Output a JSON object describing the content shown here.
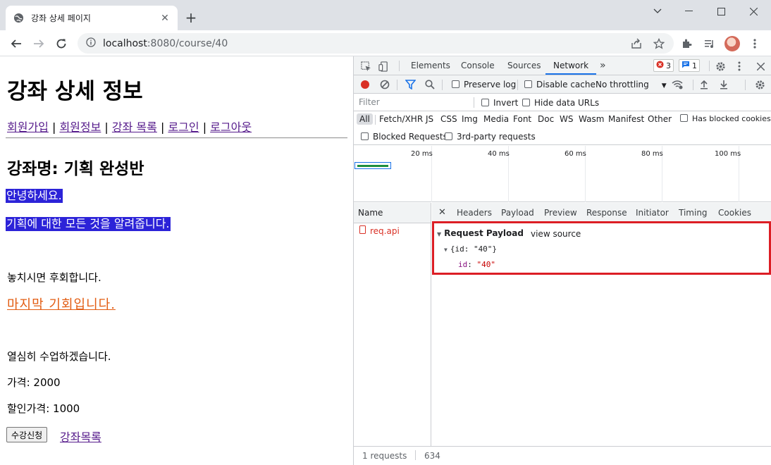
{
  "tab": {
    "title": "강좌 상세 페이지"
  },
  "address": {
    "host": "localhost",
    "path": ":8080/course/40"
  },
  "page": {
    "heading": "강좌 상세 정보",
    "nav": [
      "회원가입",
      "회원정보",
      "강좌 목록",
      "로그인",
      "로그아웃"
    ],
    "sep": " | ",
    "course_title": "강좌명: 기획 완성반",
    "highlight1": "안녕하세요.",
    "highlight2": "기획에 대한 모든 것을 알려줍니다.",
    "text1": "놓치시면 후회합니다.",
    "orange_text": "마지막 기회입니다.",
    "text2": "열심히 수업하겠습니다.",
    "price": "가격: 2000",
    "discount_price": "할인가격: 1000",
    "enroll_button": "수강신청",
    "list_link": "강좌목록"
  },
  "devtools": {
    "tabs": [
      "Elements",
      "Console",
      "Sources",
      "Network"
    ],
    "more": "»",
    "errors": "3",
    "messages": "1",
    "toolbar": {
      "preserve_log": "Preserve log",
      "disable_cache": "Disable cache",
      "throttling": "No throttling"
    },
    "filter": {
      "placeholder": "Filter",
      "invert": "Invert",
      "hide_data_urls": "Hide data URLs"
    },
    "types": [
      "All",
      "Fetch/XHR",
      "JS",
      "CSS",
      "Img",
      "Media",
      "Font",
      "Doc",
      "WS",
      "Wasm",
      "Manifest",
      "Other"
    ],
    "has_blocked_cookies": "Has blocked cookies",
    "blocked_requests": "Blocked Requests",
    "third_party": "3rd-party requests",
    "timeline_labels": [
      "20 ms",
      "40 ms",
      "60 ms",
      "80 ms",
      "100 ms"
    ],
    "name_header": "Name",
    "request_name": "req.api",
    "detail_tabs": [
      "Headers",
      "Payload",
      "Preview",
      "Response",
      "Initiator",
      "Timing",
      "Cookies"
    ],
    "payload": {
      "title": "Request Payload",
      "view_source": "view source",
      "object_summary": "{id: \"40\"}",
      "key": "id",
      "value": "\"40\""
    },
    "footer_requests": "1 requests",
    "footer_size": "634"
  },
  "colors": {
    "highlight_bg": "#2c23d8",
    "orange": "#e25c12",
    "link": "#551a8b",
    "payload_border": "#dc1e25",
    "accent": "#1a73e8"
  }
}
